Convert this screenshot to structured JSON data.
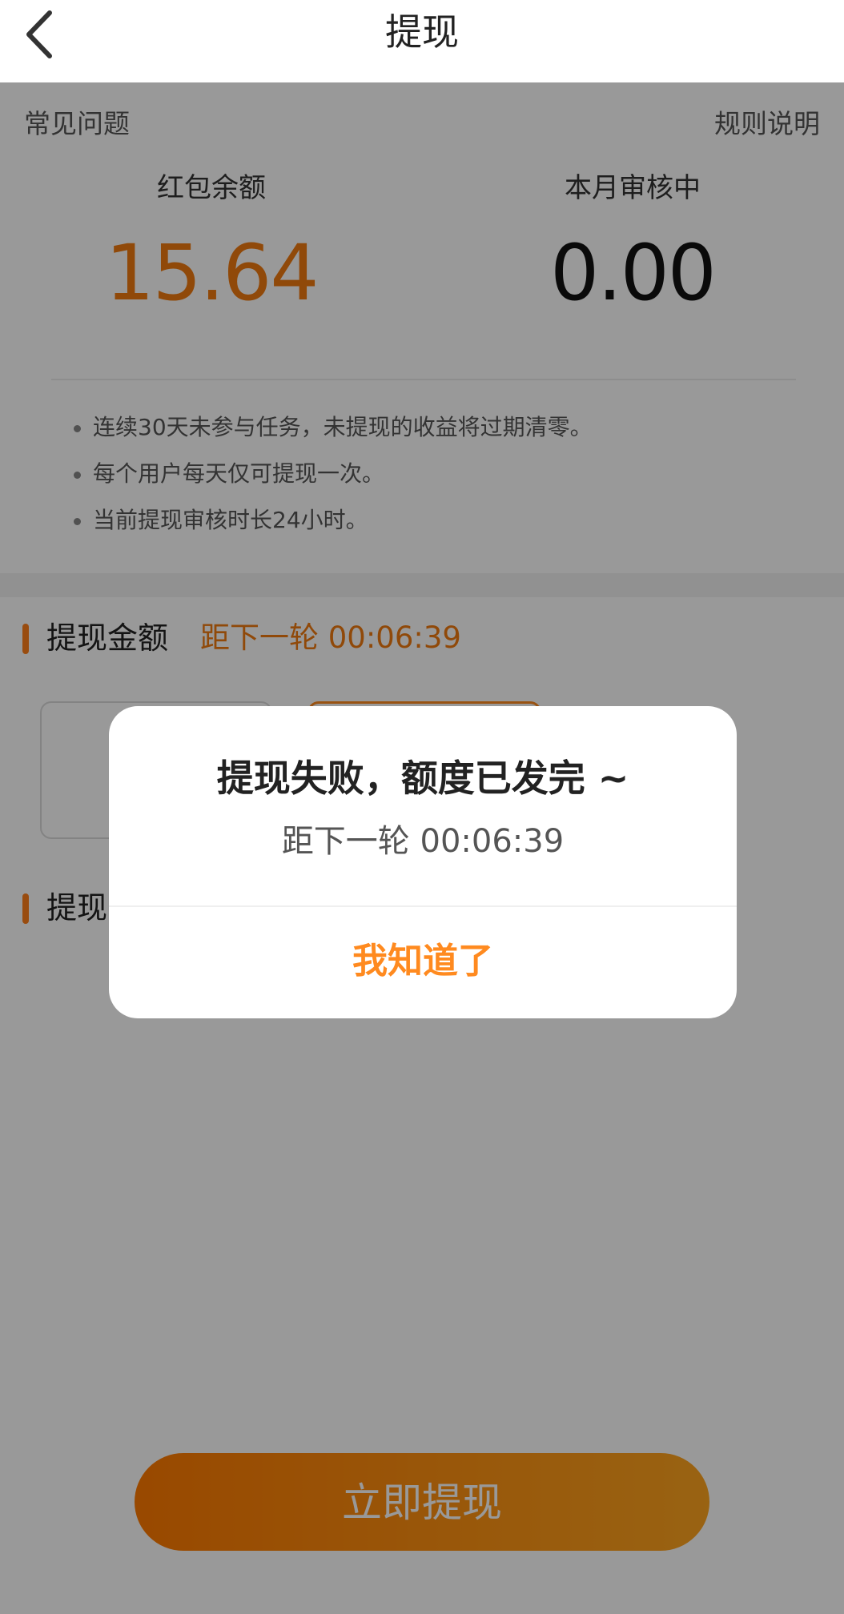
{
  "header": {
    "title": "提现",
    "back_icon": "chevron-left-icon"
  },
  "summary": {
    "faq_link": "常见问题",
    "rules_link": "规则说明",
    "balance_label": "红包余额",
    "balance_value": "15.64",
    "pending_label": "本月审核中",
    "pending_value": "0.00",
    "notes": [
      "连续30天未参与任务，未提现的收益将过期清零。",
      "每个用户每天仅可提现一次。",
      "当前提现审核时长24小时。"
    ]
  },
  "amount_section": {
    "title": "提现金额",
    "countdown": "距下一轮 00:06:39"
  },
  "method_section": {
    "title_visible": "提现"
  },
  "withdraw_button": "立即提现",
  "dialog": {
    "title": "提现失败，额度已发完 ~",
    "subtitle": "距下一轮 00:06:39",
    "confirm": "我知道了"
  },
  "colors": {
    "accent": "#ff8a1f",
    "amount_orange": "#f07b10",
    "overlay": "rgba(0,0,0,0.40)"
  }
}
